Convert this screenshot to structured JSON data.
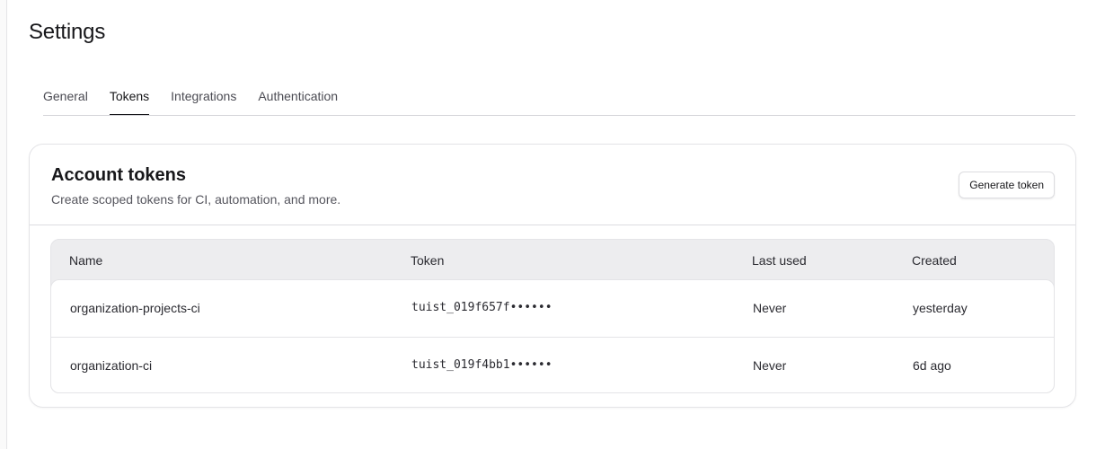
{
  "page": {
    "title": "Settings"
  },
  "tabs": [
    {
      "label": "General",
      "active": false
    },
    {
      "label": "Tokens",
      "active": true
    },
    {
      "label": "Integrations",
      "active": false
    },
    {
      "label": "Authentication",
      "active": false
    }
  ],
  "account_tokens": {
    "title": "Account tokens",
    "subtitle": "Create scoped tokens for CI, automation, and more.",
    "generate_button": "Generate token",
    "table": {
      "headers": {
        "name": "Name",
        "token": "Token",
        "last_used": "Last used",
        "created": "Created"
      },
      "rows": [
        {
          "name": "organization-projects-ci",
          "token": "tuist_019f657f••••••",
          "last_used": "Never",
          "created": "yesterday"
        },
        {
          "name": "organization-ci",
          "token": "tuist_019f4bb1••••••",
          "last_used": "Never",
          "created": "6d ago"
        }
      ]
    }
  }
}
